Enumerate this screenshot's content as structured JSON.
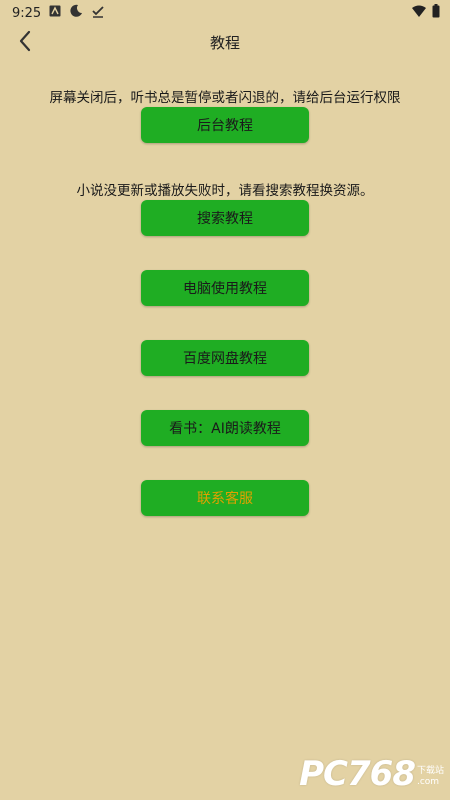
{
  "status_bar": {
    "time": "9:25",
    "icons_left": [
      "a-notification-icon",
      "moon-notification-icon",
      "check-notification-icon"
    ],
    "icons_right": [
      "wifi-icon",
      "battery-icon"
    ]
  },
  "header": {
    "title": "教程",
    "back_icon": "chevron-left-icon"
  },
  "notices": {
    "background_notice": "屏幕关闭后，听书总是暂停或者闪退的，请给后台运行权限",
    "source_notice": "小说没更新或播放失败时，请看搜索教程换资源。"
  },
  "buttons": {
    "background_tutorial": "后台教程",
    "search_tutorial": "搜索教程",
    "pc_tutorial": "电脑使用教程",
    "baidu_tutorial": "百度网盘教程",
    "ai_reading_tutorial": "看书：AI朗读教程",
    "contact_service": "联系客服"
  },
  "watermark": {
    "main": "PC768",
    "side_top": "下载站",
    "side_bottom": ".com"
  },
  "colors": {
    "background": "#e3d2a4",
    "button_green": "#1fad23",
    "contact_text": "#e0a100"
  }
}
